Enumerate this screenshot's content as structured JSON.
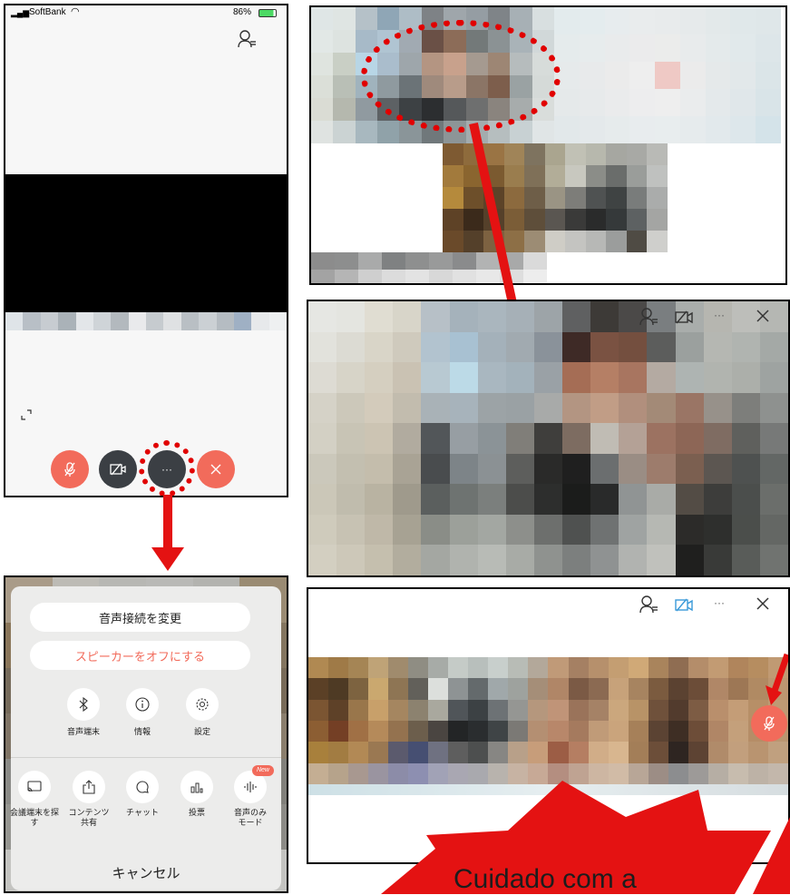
{
  "status_bar": {
    "carrier": "SoftBank",
    "battery": "86%"
  },
  "sheet": {
    "change_audio": "音声接続を変更",
    "speaker_off": "スピーカーをオフにする",
    "row1": [
      {
        "label": "音声端末",
        "icon": "bluetooth-icon"
      },
      {
        "label": "情報",
        "icon": "info-icon"
      },
      {
        "label": "設定",
        "icon": "gear-icon"
      }
    ],
    "row2": [
      {
        "label": "会議端末を探す",
        "icon": "cast-icon"
      },
      {
        "label": "コンテンツ共有",
        "icon": "share-icon"
      },
      {
        "label": "チャット",
        "icon": "chat-icon"
      },
      {
        "label": "投票",
        "icon": "poll-icon"
      },
      {
        "label": "音声のみモード",
        "icon": "audio-wave-icon"
      }
    ],
    "new_badge": "New",
    "cancel": "キャンセル"
  },
  "callout": {
    "text": "Cuidado com a"
  },
  "colors": {
    "accent_red": "#f26b5b",
    "dark": "#3b3f44",
    "dotted": "#e10000",
    "arrow": "#e41212"
  }
}
